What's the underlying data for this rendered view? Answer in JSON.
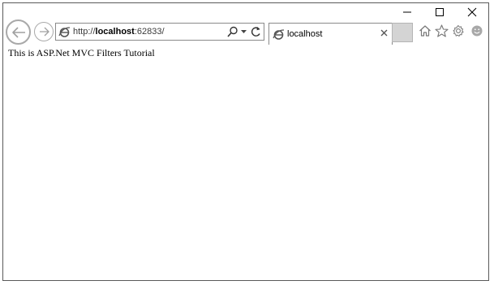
{
  "address_bar": {
    "url_prefix": "http://",
    "url_host": "localhost",
    "url_suffix": ":62833/"
  },
  "tab": {
    "title": "localhost"
  },
  "page": {
    "body_text": "This is ASP.Net MVC Filters Tutorial"
  },
  "icons": {
    "back": "back-arrow-icon",
    "forward": "forward-arrow-icon",
    "site": "internet-explorer-icon",
    "search": "search-icon",
    "dropdown": "chevron-down-icon",
    "refresh": "refresh-icon",
    "close_tab": "close-icon",
    "home": "home-icon",
    "favorites": "star-icon",
    "tools": "gear-icon",
    "feedback": "smiley-icon",
    "minimize": "minimize-icon",
    "maximize": "maximize-icon",
    "close_window": "close-icon"
  },
  "colors": {
    "window_border": "#5a5a5a",
    "control_gray": "#a9a9a9",
    "new_tab_fill": "#d4d4d4"
  }
}
